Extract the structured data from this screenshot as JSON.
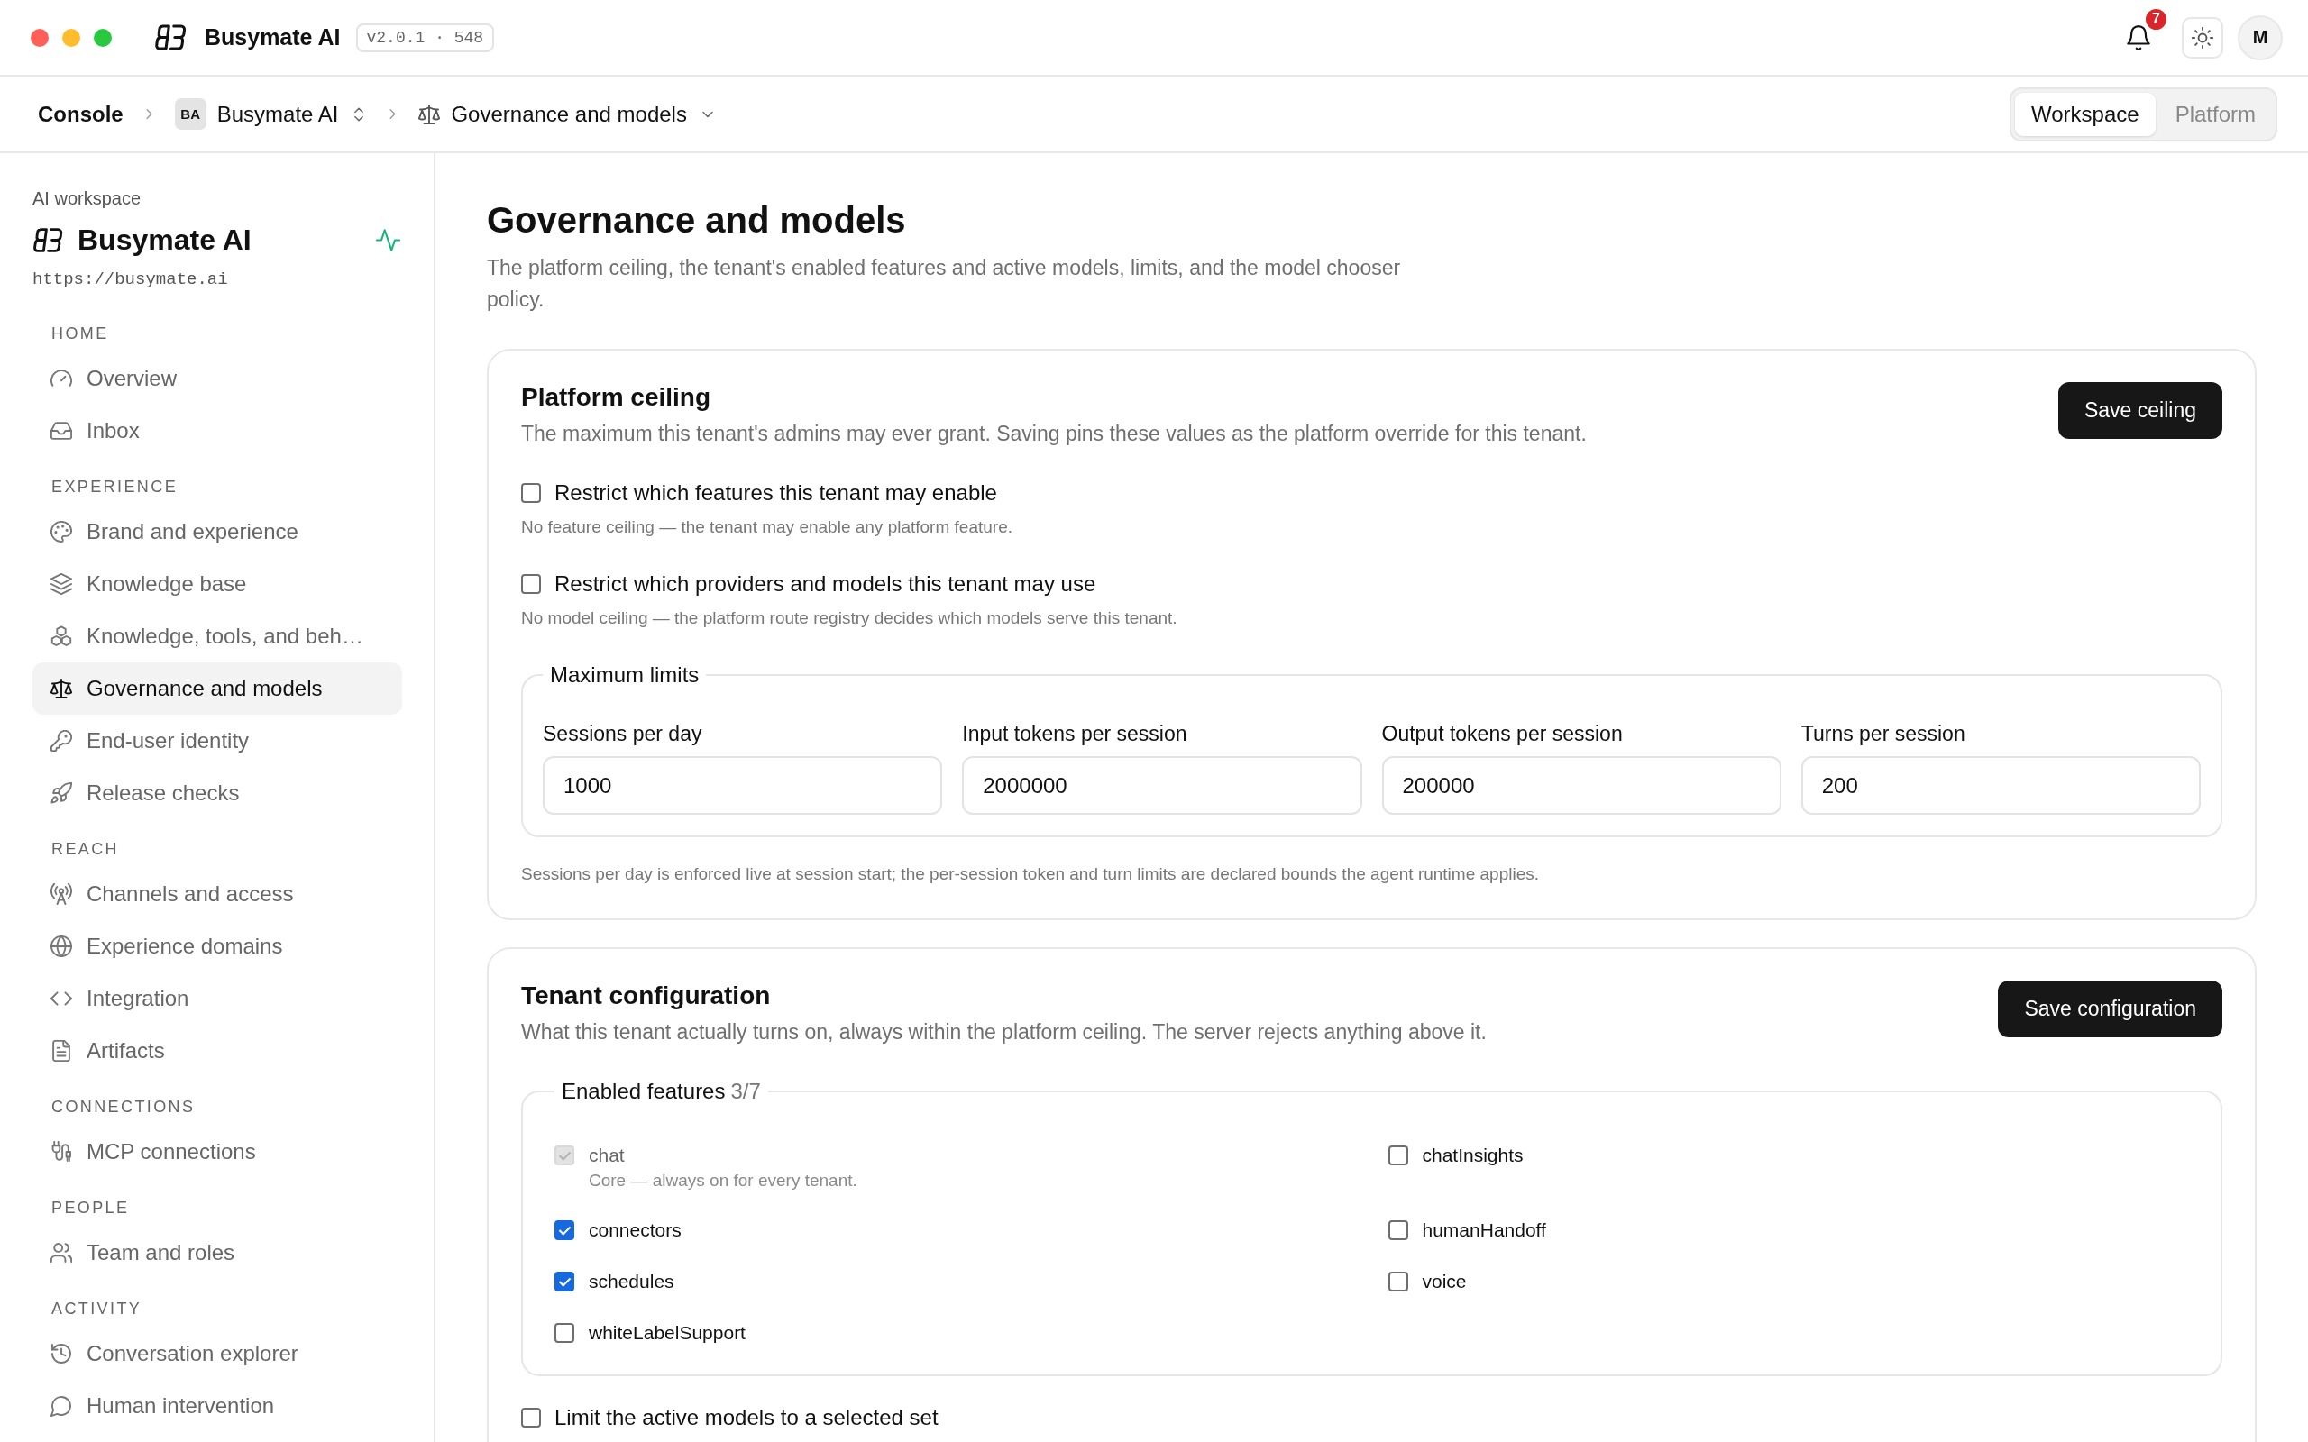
{
  "header": {
    "app_name": "Busymate AI",
    "version": "v2.0.1 · 548",
    "notification_count": "7",
    "avatar_initial": "M"
  },
  "breadcrumb": [
    {
      "label": "Console"
    },
    {
      "badge": "BA",
      "label": "Busymate AI"
    },
    {
      "label": "Governance and models"
    }
  ],
  "scope_tabs": [
    {
      "label": "Workspace",
      "selected": true
    },
    {
      "label": "Platform",
      "selected": false
    }
  ],
  "sidebar": {
    "caption": "AI workspace",
    "title": "Busymate AI",
    "url": "https://busymate.ai",
    "sections": [
      {
        "heading": "HOME",
        "items": [
          {
            "label": "Overview",
            "selected": false
          },
          {
            "label": "Inbox",
            "selected": false
          }
        ]
      },
      {
        "heading": "EXPERIENCE",
        "items": [
          {
            "label": "Brand and experience",
            "selected": false
          },
          {
            "label": "Knowledge base",
            "selected": false
          },
          {
            "label": "Knowledge, tools, and beh…",
            "selected": false
          },
          {
            "label": "Governance and models",
            "selected": true
          },
          {
            "label": "End-user identity",
            "selected": false
          },
          {
            "label": "Release checks",
            "selected": false
          }
        ]
      },
      {
        "heading": "REACH",
        "items": [
          {
            "label": "Channels and access",
            "selected": false
          },
          {
            "label": "Experience domains",
            "selected": false
          },
          {
            "label": "Integration",
            "selected": false
          },
          {
            "label": "Artifacts",
            "selected": false
          }
        ]
      },
      {
        "heading": "CONNECTIONS",
        "items": [
          {
            "label": "MCP connections",
            "selected": false
          }
        ]
      },
      {
        "heading": "PEOPLE",
        "items": [
          {
            "label": "Team and roles",
            "selected": false
          }
        ]
      },
      {
        "heading": "ACTIVITY",
        "items": [
          {
            "label": "Conversation explorer",
            "selected": false
          },
          {
            "label": "Human intervention",
            "selected": false
          }
        ]
      }
    ]
  },
  "page": {
    "title": "Governance and models",
    "description": "The platform ceiling, the tenant's enabled features and active models, limits, and the model chooser policy."
  },
  "platform_ceiling": {
    "title": "Platform ceiling",
    "description": "The maximum this tenant's admins may ever grant. Saving pins these values as the platform override for this tenant.",
    "save_button": "Save ceiling",
    "options": [
      {
        "label": "Restrict which features this tenant may enable",
        "hint": "No feature ceiling — the tenant may enable any platform feature.",
        "checked": false
      },
      {
        "label": "Restrict which providers and models this tenant may use",
        "hint": "No model ceiling — the platform route registry decides which models serve this tenant.",
        "checked": false
      }
    ],
    "limits": {
      "legend": "Maximum limits",
      "fields": [
        {
          "label": "Sessions per day",
          "value": "1000"
        },
        {
          "label": "Input tokens per session",
          "value": "2000000"
        },
        {
          "label": "Output tokens per session",
          "value": "200000"
        },
        {
          "label": "Turns per session",
          "value": "200"
        }
      ]
    },
    "note": "Sessions per day is enforced live at session start; the per-session token and turn limits are declared bounds the agent runtime applies."
  },
  "tenant_configuration": {
    "title": "Tenant configuration",
    "description": "What this tenant actually turns on, always within the platform ceiling. The server rejects anything above it.",
    "save_button": "Save configuration",
    "features": {
      "legend": "Enabled features",
      "count": "3/7",
      "items": [
        {
          "label": "chat",
          "hint": "Core — always on for every tenant.",
          "checked": true,
          "disabled": true
        },
        {
          "label": "chatInsights",
          "checked": false,
          "disabled": false
        },
        {
          "label": "connectors",
          "checked": true,
          "disabled": false
        },
        {
          "label": "humanHandoff",
          "checked": false,
          "disabled": false
        },
        {
          "label": "schedules",
          "checked": true,
          "disabled": false
        },
        {
          "label": "voice",
          "checked": false,
          "disabled": false
        },
        {
          "label": "whiteLabelSupport",
          "checked": false,
          "disabled": false
        }
      ]
    },
    "model_limit": {
      "label": "Limit the active models to a selected set",
      "checked": false
    }
  }
}
